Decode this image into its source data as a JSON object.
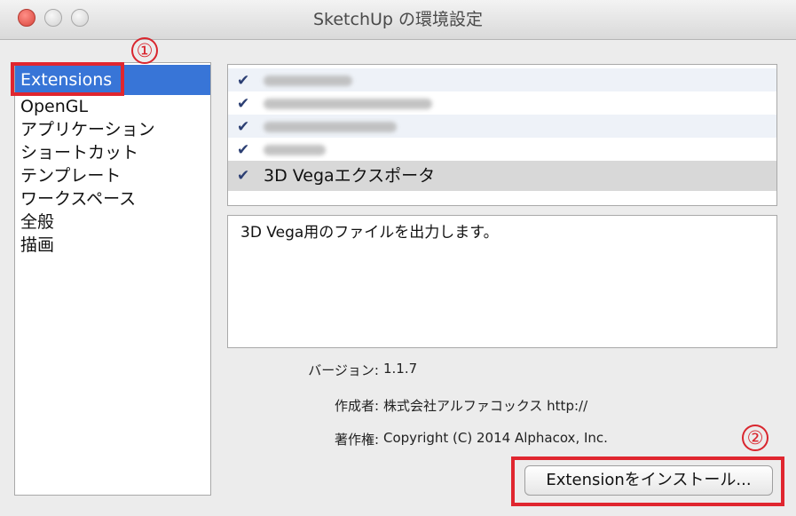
{
  "window": {
    "title": "SketchUp の環境設定"
  },
  "sidebar": {
    "items": [
      {
        "label": "Extensions",
        "selected": true
      },
      {
        "label": "OpenGL"
      },
      {
        "label": "アプリケーション"
      },
      {
        "label": "ショートカット"
      },
      {
        "label": "テンプレート"
      },
      {
        "label": "ワークスペース"
      },
      {
        "label": "全般"
      },
      {
        "label": "描画"
      }
    ]
  },
  "extensions": {
    "check_glyph": "✔",
    "items": [
      {
        "checked": true,
        "label_obscured": true
      },
      {
        "checked": true,
        "label_obscured": true
      },
      {
        "checked": true,
        "label_obscured": true
      },
      {
        "checked": true,
        "label_obscured": true
      },
      {
        "checked": true,
        "label": "3D Vegaエクスポータ",
        "selected": true
      }
    ]
  },
  "details": {
    "description": "3D Vega用のファイルを出力します。",
    "version_label": "バージョン:",
    "version": "1.1.7",
    "author_label": "作成者:",
    "author": "株式会社アルファコックス http://",
    "copyright_label": "著作権:",
    "copyright": "Copyright (C) 2014 Alphacox, Inc."
  },
  "install_button": {
    "label": "Extensionをインストール..."
  },
  "annotations": [
    {
      "label": "①",
      "target": "sidebar-item-extensions"
    },
    {
      "label": "②",
      "target": "install-extension-button"
    }
  ],
  "colors": {
    "selection": "#3875d7",
    "annotation": "#e0262f",
    "checkbox": "#2c3f73"
  }
}
